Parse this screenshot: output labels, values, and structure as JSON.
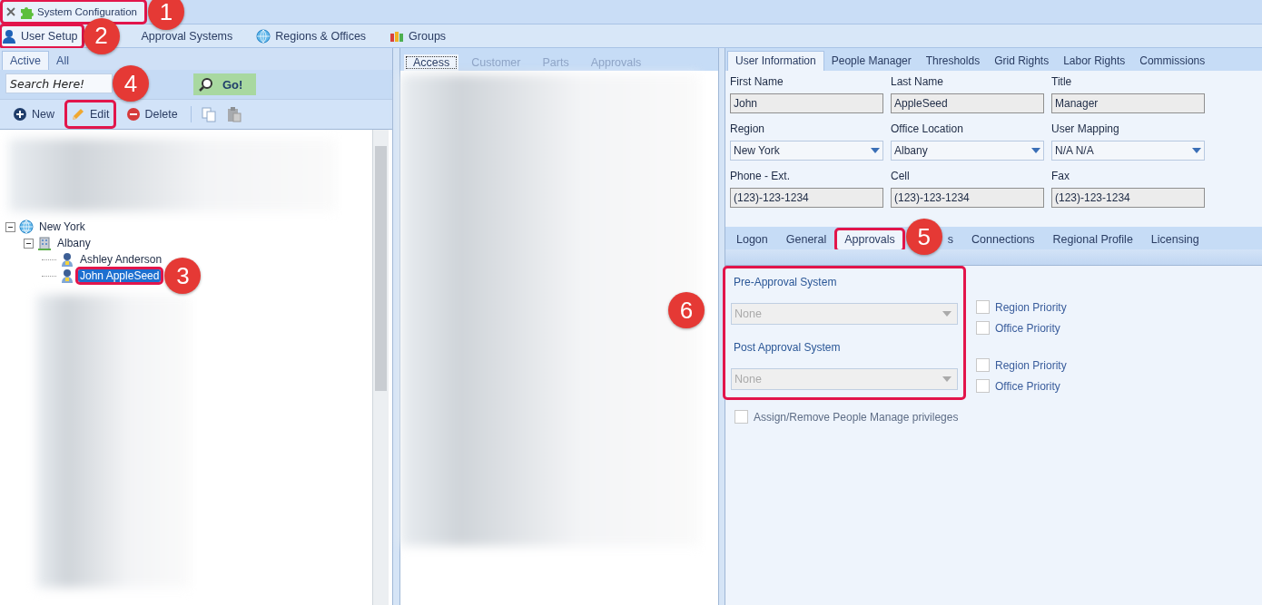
{
  "document_tab": {
    "title": "System Configuration",
    "highlighted": true
  },
  "nav": [
    {
      "label": "User Setup",
      "selected": true,
      "highlighted": true
    },
    {
      "label": "Approval Systems",
      "selected": false,
      "highlighted": false
    },
    {
      "label": "Regions & Offices",
      "selected": false,
      "highlighted": false
    },
    {
      "label": "Groups",
      "selected": false,
      "highlighted": false
    }
  ],
  "left_panel": {
    "tabs": [
      {
        "label": "Active",
        "selected": true
      },
      {
        "label": "All",
        "selected": false
      }
    ],
    "search": {
      "placeholder": "Search Here!"
    },
    "go_button": "Go!",
    "toolbar": [
      {
        "label": "New",
        "highlighted": false
      },
      {
        "label": "Edit",
        "highlighted": true
      },
      {
        "label": "Delete",
        "highlighted": false
      }
    ],
    "tree": [
      {
        "label": "New York",
        "expanded": true,
        "selected": false,
        "highlighted": false,
        "children": [
          {
            "label": "Albany",
            "expanded": true,
            "selected": false,
            "highlighted": false,
            "children": [
              {
                "label": "Ashley Anderson",
                "selected": false,
                "highlighted": false
              },
              {
                "label": "John AppleSeed",
                "selected": true,
                "highlighted": true
              }
            ]
          }
        ]
      }
    ]
  },
  "middle_panel": {
    "tabs": [
      {
        "label": "Access",
        "selected": true,
        "disabled": false
      },
      {
        "label": "Customer",
        "selected": false,
        "disabled": true
      },
      {
        "label": "Parts",
        "selected": false,
        "disabled": true
      },
      {
        "label": "Approvals",
        "selected": false,
        "disabled": true
      }
    ]
  },
  "right_panel": {
    "tabs": [
      {
        "label": "User Information",
        "selected": true
      },
      {
        "label": "People Manager",
        "selected": false
      },
      {
        "label": "Thresholds",
        "selected": false
      },
      {
        "label": "Grid Rights",
        "selected": false
      },
      {
        "label": "Labor Rights",
        "selected": false
      },
      {
        "label": "Commissions",
        "selected": false
      }
    ],
    "fields": [
      {
        "label": "First Name",
        "value": "John",
        "kind": "text"
      },
      {
        "label": "Last Name",
        "value": "AppleSeed",
        "kind": "text"
      },
      {
        "label": "Title",
        "value": "Manager",
        "kind": "text"
      },
      {
        "label": "Region",
        "value": "New York",
        "kind": "dropdown"
      },
      {
        "label": "Office Location",
        "value": "Albany",
        "kind": "dropdown"
      },
      {
        "label": "User Mapping",
        "value": "N/A N/A",
        "kind": "dropdown"
      },
      {
        "label": "Phone - Ext.",
        "value": "(123)-123-1234",
        "kind": "text"
      },
      {
        "label": "Cell",
        "value": "(123)-123-1234",
        "kind": "text"
      },
      {
        "label": "Fax",
        "value": "(123)-123-1234",
        "kind": "text"
      }
    ],
    "sub_tabs": [
      {
        "label": "Logon",
        "selected": false,
        "highlighted": false
      },
      {
        "label": "General",
        "selected": false,
        "highlighted": false
      },
      {
        "label": "Approvals",
        "selected": true,
        "highlighted": true
      },
      {
        "label": "s",
        "selected": false,
        "highlighted": false
      },
      {
        "label": "Connections",
        "selected": false,
        "highlighted": false
      },
      {
        "label": "Regional Profile",
        "selected": false,
        "highlighted": false
      },
      {
        "label": "Licensing",
        "selected": false,
        "highlighted": false
      }
    ],
    "approvals": {
      "highlighted": true,
      "systems": [
        {
          "label": "Pre-Approval System",
          "value": "None",
          "disabled": true,
          "priorities": [
            {
              "label": "Region Priority",
              "checked": false
            },
            {
              "label": "Office Priority",
              "checked": false
            }
          ]
        },
        {
          "label": "Post Approval System",
          "value": "None",
          "disabled": true,
          "priorities": [
            {
              "label": "Region Priority",
              "checked": false
            },
            {
              "label": "Office Priority",
              "checked": false
            }
          ]
        }
      ],
      "assign": {
        "label": "Assign/Remove People Manage privileges",
        "checked": false,
        "disabled": true
      }
    }
  },
  "callouts": [
    {
      "number": "1"
    },
    {
      "number": "2"
    },
    {
      "number": "3"
    },
    {
      "number": "4"
    },
    {
      "number": "5"
    },
    {
      "number": "6"
    }
  ]
}
